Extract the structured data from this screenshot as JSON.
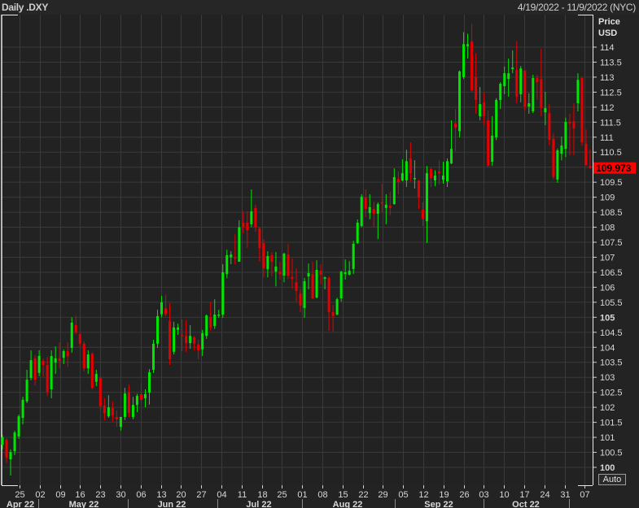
{
  "header": {
    "title": "Daily .DXY",
    "range": "4/19/2022 - 11/9/2022 (NYC)"
  },
  "axis": {
    "unit_line1": "Price",
    "unit_line2": "USD",
    "auto_label": "Auto"
  },
  "last_price": {
    "label": "109.973",
    "value": 109.973
  },
  "colors": {
    "up": "#00e600",
    "down": "#e60000",
    "background": "#222222",
    "grid": "#3a3a3a",
    "last_price_bg": "#ff0000"
  },
  "chart_data": {
    "type": "candlestick",
    "title": "Daily .DXY",
    "ylabel": "Price USD",
    "ylim": [
      99.5,
      115.0
    ],
    "grid": true,
    "y_ticks": [
      100,
      100.5,
      101,
      101.5,
      102,
      102.5,
      103,
      103.5,
      104,
      104.5,
      105,
      105.5,
      106,
      106.5,
      107,
      107.5,
      108,
      108.5,
      109,
      109.5,
      110,
      110.5,
      111,
      111.5,
      112,
      112.5,
      113,
      113.5,
      114
    ],
    "y_tick_labels": [
      "100",
      "100.5",
      "101",
      "101.5",
      "102",
      "102.5",
      "103",
      "103.5",
      "104",
      "104.5",
      "105",
      "105.5",
      "106",
      "106.5",
      "107",
      "107.5",
      "108",
      "108.5",
      "109",
      "109.5",
      "110",
      "110.5",
      "111",
      "111.5",
      "112",
      "112.5",
      "113",
      "113.5",
      "114"
    ],
    "bold_ticks": [
      "100",
      "105"
    ],
    "x_week_ticks": [
      "25",
      "02",
      "09",
      "16",
      "23",
      "30",
      "06",
      "13",
      "20",
      "27",
      "04",
      "11",
      "18",
      "25",
      "01",
      "08",
      "15",
      "22",
      "29",
      "05",
      "12",
      "19",
      "26",
      "03",
      "10",
      "17",
      "24",
      "31",
      "07"
    ],
    "x_months": [
      "Apr 22",
      "May 22",
      "Jun 22",
      "Jul 22",
      "Aug 22",
      "Sep 22",
      "Oct 22"
    ],
    "ohlc_fields": [
      "open",
      "high",
      "low",
      "close"
    ],
    "ohlc": [
      [
        100.75,
        101.08,
        100.6,
        101.0
      ],
      [
        100.92,
        100.97,
        100.14,
        100.32
      ],
      [
        100.27,
        100.6,
        99.73,
        100.51
      ],
      [
        100.54,
        101.22,
        100.41,
        101.16
      ],
      [
        101.03,
        101.76,
        100.95,
        101.7
      ],
      [
        101.65,
        102.35,
        101.43,
        102.25
      ],
      [
        102.2,
        103.25,
        102.14,
        102.92
      ],
      [
        102.98,
        103.9,
        102.9,
        103.57
      ],
      [
        103.63,
        103.74,
        102.73,
        102.92
      ],
      [
        103.15,
        103.9,
        103.04,
        103.71
      ],
      [
        103.55,
        103.63,
        103.03,
        103.41
      ],
      [
        103.41,
        103.68,
        102.38,
        102.52
      ],
      [
        102.6,
        103.9,
        102.3,
        103.71
      ],
      [
        103.49,
        104.03,
        103.11,
        103.63
      ],
      [
        103.63,
        104.17,
        103.3,
        103.55
      ],
      [
        103.65,
        103.93,
        103.44,
        103.87
      ],
      [
        103.87,
        104.17,
        103.35,
        103.7
      ],
      [
        103.98,
        105.0,
        103.82,
        104.82
      ],
      [
        104.74,
        105.05,
        104.44,
        104.5
      ],
      [
        104.44,
        104.47,
        104.03,
        104.12
      ],
      [
        104.12,
        104.2,
        103.19,
        103.3
      ],
      [
        103.3,
        103.9,
        103.11,
        103.76
      ],
      [
        103.79,
        103.84,
        102.6,
        102.65
      ],
      [
        102.85,
        103.25,
        102.71,
        103.11
      ],
      [
        102.98,
        103.03,
        101.92,
        102.03
      ],
      [
        102.06,
        102.3,
        101.57,
        101.8
      ],
      [
        101.7,
        102.4,
        101.65,
        102.0
      ],
      [
        101.98,
        102.19,
        101.52,
        101.73
      ],
      [
        101.68,
        101.9,
        101.35,
        101.6
      ],
      [
        101.35,
        101.68,
        101.22,
        101.68
      ],
      [
        101.68,
        102.65,
        101.57,
        102.46
      ],
      [
        102.49,
        102.76,
        101.68,
        101.81
      ],
      [
        101.68,
        102.35,
        101.6,
        102.08
      ],
      [
        102.08,
        102.45,
        101.84,
        102.38
      ],
      [
        102.44,
        102.8,
        102.11,
        102.25
      ],
      [
        102.3,
        102.6,
        102.0,
        102.44
      ],
      [
        102.49,
        103.27,
        102.09,
        103.17
      ],
      [
        103.25,
        104.25,
        103.14,
        104.12
      ],
      [
        104.12,
        105.25,
        103.98,
        105.04
      ],
      [
        105.1,
        105.71,
        105.0,
        105.5
      ],
      [
        105.3,
        105.76,
        105.03,
        105.1
      ],
      [
        104.87,
        105.47,
        103.41,
        103.6
      ],
      [
        103.85,
        104.85,
        103.76,
        104.66
      ],
      [
        104.58,
        104.79,
        104.41,
        104.66
      ],
      [
        104.41,
        104.93,
        103.87,
        104.38
      ],
      [
        104.38,
        104.9,
        103.84,
        104.14
      ],
      [
        104.14,
        104.74,
        103.95,
        104.38
      ],
      [
        104.33,
        104.38,
        103.9,
        104.12
      ],
      [
        104.09,
        104.25,
        103.6,
        103.9
      ],
      [
        103.93,
        104.58,
        103.71,
        104.47
      ],
      [
        104.38,
        105.09,
        104.28,
        105.06
      ],
      [
        105.0,
        105.5,
        104.55,
        104.66
      ],
      [
        104.71,
        105.6,
        104.61,
        105.09
      ],
      [
        105.06,
        105.25,
        104.98,
        105.09
      ],
      [
        105.09,
        106.77,
        104.98,
        106.5
      ],
      [
        106.44,
        107.25,
        106.3,
        107.07
      ],
      [
        107.0,
        107.2,
        106.77,
        107.09
      ],
      [
        107.0,
        107.76,
        106.77,
        106.95
      ],
      [
        106.85,
        108.23,
        106.85,
        108.0
      ],
      [
        108.15,
        108.53,
        107.8,
        108.01
      ],
      [
        108.15,
        108.53,
        107.31,
        107.9
      ],
      [
        108.1,
        109.26,
        108.0,
        108.53
      ],
      [
        108.64,
        108.75,
        107.85,
        108.01
      ],
      [
        107.96,
        108.0,
        106.85,
        107.31
      ],
      [
        107.47,
        107.6,
        106.33,
        106.63
      ],
      [
        106.6,
        107.2,
        106.33,
        107.04
      ],
      [
        107.07,
        107.17,
        106.36,
        106.85
      ],
      [
        106.52,
        107.17,
        106.03,
        106.69
      ],
      [
        106.52,
        106.85,
        106.25,
        106.44
      ],
      [
        106.39,
        107.15,
        106.17,
        107.12
      ],
      [
        107.09,
        107.44,
        106.28,
        106.39
      ],
      [
        106.34,
        106.96,
        105.95,
        106.28
      ],
      [
        106.17,
        106.63,
        105.52,
        105.88
      ],
      [
        105.79,
        105.95,
        105.17,
        105.39
      ],
      [
        105.31,
        106.31,
        104.98,
        106.2
      ],
      [
        106.36,
        106.79,
        105.93,
        106.47
      ],
      [
        106.44,
        106.85,
        105.6,
        105.63
      ],
      [
        105.66,
        106.9,
        105.63,
        106.58
      ],
      [
        106.55,
        106.77,
        106.09,
        106.42
      ],
      [
        106.28,
        106.36,
        105.93,
        106.33
      ],
      [
        106.31,
        106.36,
        104.55,
        105.17
      ],
      [
        105.17,
        105.41,
        104.52,
        105.04
      ],
      [
        105.09,
        105.65,
        105.06,
        105.6
      ],
      [
        105.63,
        106.55,
        105.52,
        106.52
      ],
      [
        106.44,
        106.93,
        106.25,
        106.5
      ],
      [
        106.42,
        106.87,
        106.39,
        106.55
      ],
      [
        106.61,
        107.55,
        106.44,
        107.45
      ],
      [
        107.47,
        108.26,
        107.44,
        108.15
      ],
      [
        108.04,
        109.1,
        108.0,
        109.02
      ],
      [
        108.99,
        109.26,
        108.34,
        108.61
      ],
      [
        108.47,
        109.1,
        108.26,
        108.67
      ],
      [
        108.61,
        108.85,
        108.0,
        108.45
      ],
      [
        108.45,
        108.83,
        107.6,
        108.77
      ],
      [
        108.83,
        109.45,
        108.5,
        108.8
      ],
      [
        108.64,
        109.1,
        108.1,
        108.75
      ],
      [
        108.72,
        109.18,
        108.4,
        108.64
      ],
      [
        108.77,
        109.96,
        108.75,
        109.67
      ],
      [
        109.61,
        109.85,
        109.1,
        109.5
      ],
      [
        109.56,
        110.26,
        109.53,
        109.8
      ],
      [
        109.56,
        110.58,
        109.34,
        110.2
      ],
      [
        110.29,
        110.83,
        109.53,
        109.8
      ],
      [
        109.6,
        110.23,
        109.29,
        109.64
      ],
      [
        109.56,
        109.56,
        108.61,
        108.99
      ],
      [
        108.58,
        108.83,
        108.04,
        108.28
      ],
      [
        108.2,
        110.04,
        107.47,
        109.8
      ],
      [
        109.94,
        110.0,
        109.34,
        109.64
      ],
      [
        109.56,
        109.9,
        109.37,
        109.72
      ],
      [
        109.86,
        110.23,
        109.42,
        109.8
      ],
      [
        109.58,
        110.18,
        109.45,
        109.72
      ],
      [
        109.53,
        110.29,
        109.34,
        110.2
      ],
      [
        110.13,
        111.56,
        110.1,
        110.61
      ],
      [
        111.45,
        111.94,
        110.53,
        111.32
      ],
      [
        111.2,
        113.22,
        110.99,
        113.19
      ],
      [
        113.0,
        114.5,
        112.94,
        114.1
      ],
      [
        114.03,
        114.45,
        113.62,
        114.1
      ],
      [
        114.19,
        114.77,
        112.5,
        112.56
      ],
      [
        113.0,
        113.8,
        111.78,
        112.24
      ],
      [
        111.7,
        112.67,
        111.56,
        112.1
      ],
      [
        112.16,
        112.48,
        111.4,
        111.7
      ],
      [
        111.56,
        111.89,
        110.0,
        110.05
      ],
      [
        110.18,
        111.7,
        110.05,
        111.05
      ],
      [
        110.99,
        112.3,
        110.9,
        112.24
      ],
      [
        112.24,
        112.83,
        111.94,
        112.78
      ],
      [
        112.7,
        113.35,
        112.43,
        113.13
      ],
      [
        112.94,
        113.62,
        112.35,
        113.13
      ],
      [
        113.27,
        113.89,
        113.13,
        113.32
      ],
      [
        113.24,
        114.2,
        112.13,
        112.35
      ],
      [
        112.43,
        113.37,
        112.16,
        113.29
      ],
      [
        113.21,
        113.24,
        111.89,
        112.02
      ],
      [
        112.02,
        112.46,
        111.78,
        112.13
      ],
      [
        111.86,
        113.08,
        111.8,
        112.97
      ],
      [
        112.97,
        113.08,
        112.24,
        112.83
      ],
      [
        112.94,
        113.94,
        111.7,
        111.97
      ],
      [
        111.83,
        112.51,
        111.4,
        111.97
      ],
      [
        111.8,
        112.1,
        110.72,
        110.91
      ],
      [
        110.94,
        111.12,
        109.59,
        109.67
      ],
      [
        109.59,
        110.62,
        109.48,
        110.56
      ],
      [
        110.45,
        111.02,
        110.23,
        110.72
      ],
      [
        110.61,
        111.65,
        110.34,
        111.51
      ],
      [
        111.51,
        111.78,
        110.4,
        111.45
      ],
      [
        111.53,
        112.13,
        110.4,
        111.29
      ],
      [
        112.13,
        113.13,
        111.86,
        112.91
      ],
      [
        112.97,
        113.0,
        110.72,
        110.83
      ],
      [
        110.78,
        111.26,
        110.04,
        110.07
      ],
      [
        110.04,
        110.58,
        109.95,
        109.973
      ]
    ]
  }
}
